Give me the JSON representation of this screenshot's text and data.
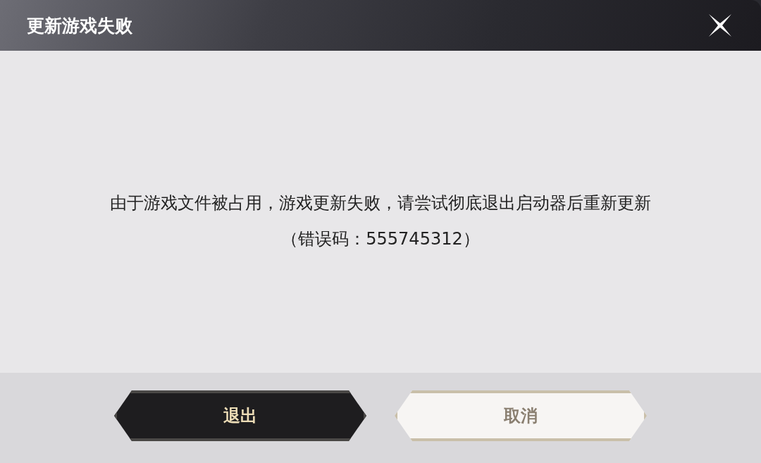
{
  "window": {
    "title": "更新游戏失败"
  },
  "message": {
    "lines": [
      "由于游戏文件被占用，游戏更新失败，请尝试彻底退出启动器后重新更新"
    ],
    "error_code": "（错误码：555745312）"
  },
  "buttons": [
    {
      "label": "退出",
      "kind": "dark"
    },
    {
      "label": "取消",
      "kind": "light"
    }
  ]
}
